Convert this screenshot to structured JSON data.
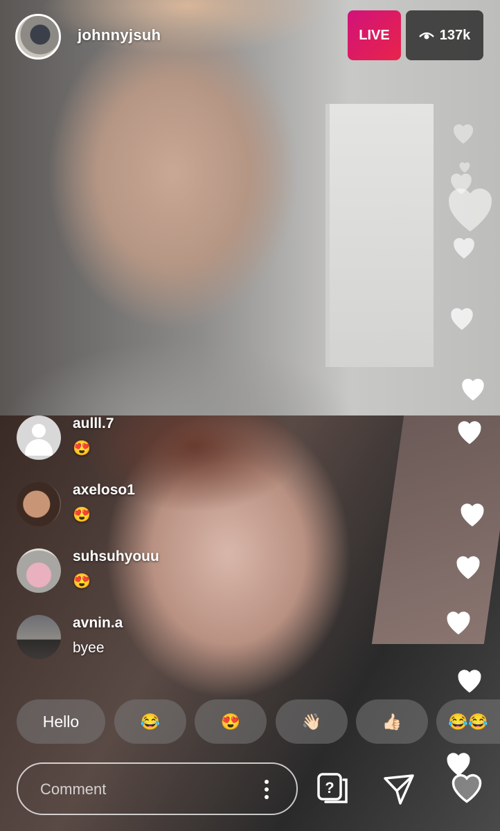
{
  "header": {
    "host_username": "johnnyjsuh",
    "live_label": "LIVE",
    "viewer_count": "137k",
    "viewer_icon": "eye-icon"
  },
  "comments": [
    {
      "username": "aulll.7",
      "text": "😍"
    },
    {
      "username": "axeloso1",
      "text": "😍"
    },
    {
      "username": "suhsuhyouu",
      "text": "😍"
    },
    {
      "username": "avnin.a",
      "text": "byee"
    }
  ],
  "quick_reactions": [
    "Hello",
    "😂",
    "😍",
    "👋🏻",
    "👍🏻",
    "😂😂"
  ],
  "composer": {
    "placeholder": "Comment",
    "more_icon": "more-vertical-icon",
    "question_icon": "question-sticker-icon",
    "send_icon": "send-icon",
    "like_icon": "heart-icon"
  },
  "colors": {
    "live_gradient_start": "#d1127a",
    "live_gradient_end": "#e8244a",
    "viewer_badge_bg": "#141414"
  }
}
